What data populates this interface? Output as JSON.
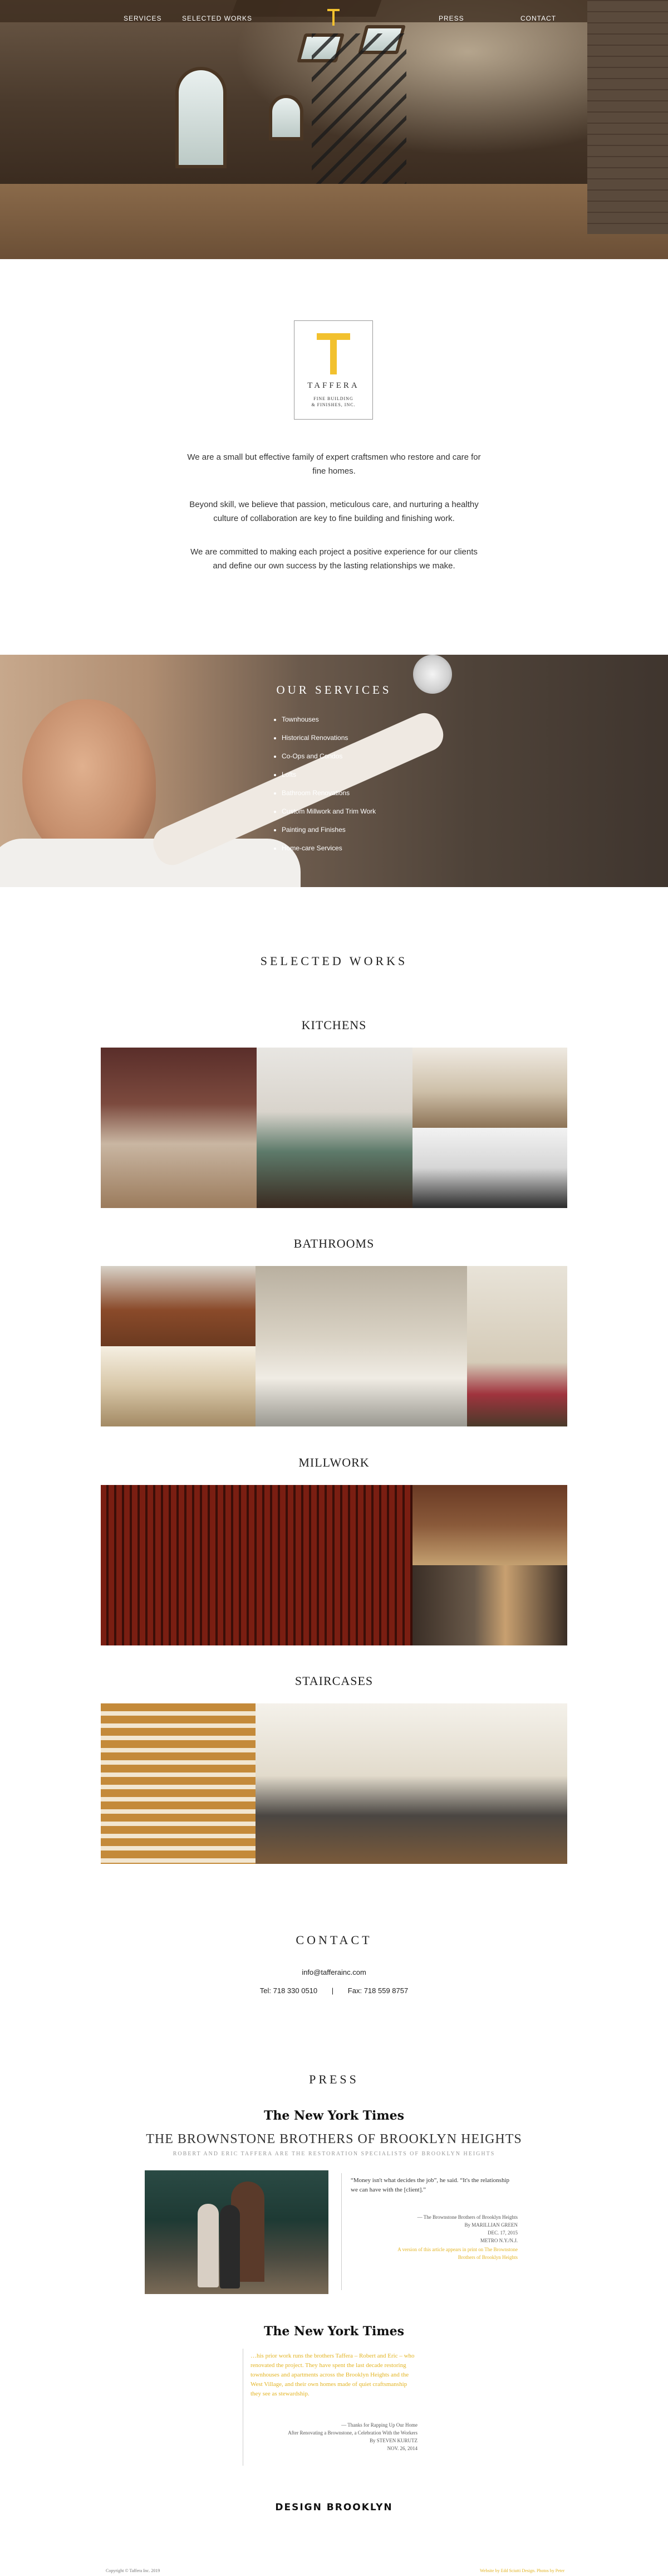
{
  "nav": {
    "services": "SERVICES",
    "selected_works": "SELECTED WORKS",
    "press": "PRESS",
    "contact": "CONTACT"
  },
  "brand": {
    "name": "TAFFERA",
    "tagline_line1": "FINE BUILDING",
    "tagline_line2": "& FINISHES, INC.",
    "color": "#f2c12e"
  },
  "intro": {
    "p1": "We are a small but effective family of expert craftsmen who restore and care for fine homes.",
    "p2": "Beyond skill, we believe that passion, meticulous care, and nurturing a healthy culture of collaboration are key to fine building and finishing work.",
    "p3": "We are committed to making each project a positive experience for our clients and define our own success by the lasting relationships we make."
  },
  "services": {
    "title": "OUR SERVICES",
    "items": [
      "Townhouses",
      "Historical Renovations",
      "Co-Ops and Condos",
      "Lofts",
      "Bathroom Renovations",
      "Custom Millwork and Trim Work",
      "Painting and Finishes",
      "Home-care Services"
    ]
  },
  "works": {
    "title": "SELECTED WORKS",
    "categories": [
      {
        "name": "KITCHENS"
      },
      {
        "name": "BATHROOMS"
      },
      {
        "name": "MILLWORK"
      },
      {
        "name": "STAIRCASES"
      }
    ]
  },
  "contact": {
    "title": "CONTACT",
    "email": "info@tafferainc.com",
    "tel": "Tel: 718 330 0510",
    "separator": "|",
    "fax": "Fax: 718 559 8757"
  },
  "press": {
    "title": "PRESS",
    "nyt_logo": "The New York Times",
    "headline": "THE BROWNSTONE BROTHERS OF BROOKLYN HEIGHTS",
    "subhead": "ROBERT AND ERIC TAFFERA ARE THE RESTORATION SPECIALISTS OF BROOKLYN HEIGHTS",
    "quote1": "“Money isn't what decides the job”, he said. “It's the relationship we can have with the [client].”",
    "source1_title": "— The Brownstone Brothers of Brooklyn Heights",
    "source1_author": "By MARILLIAN GREEN",
    "source1_date": "DEC. 17, 2015",
    "source1_section": "METRO N.Y./N.J.",
    "source1_link": "A version of this article appears in print on The Brownstone Brothers of Brooklyn Heights",
    "quote2": "…his prior work runs the brothers Taffera – Robert and Eric – who renovated the project. They have spent the last decade restoring townhouses and apartments across the Brooklyn Heights and the West Village, and their own homes made of quiet craftsmanship they see as stewardship.",
    "source2_title": "— Thanks for Rapping Up Our Home",
    "source2_desc": "After Renovating a Brownstone, a Celebration With the Workers",
    "source2_author": "By STEVEN KURUTZ",
    "source2_date": "NOV. 26, 2014",
    "design_brooklyn": "DESIGN BROOKLYN"
  },
  "footer": {
    "copyright": "Copyright © Taffera Inc. 2019",
    "credit": "Website by Edd Sciutti Design. Photos by Peter"
  },
  "icons": {
    "logo": "taffera-t-logo-icon",
    "bullet": "bullet-icon"
  }
}
